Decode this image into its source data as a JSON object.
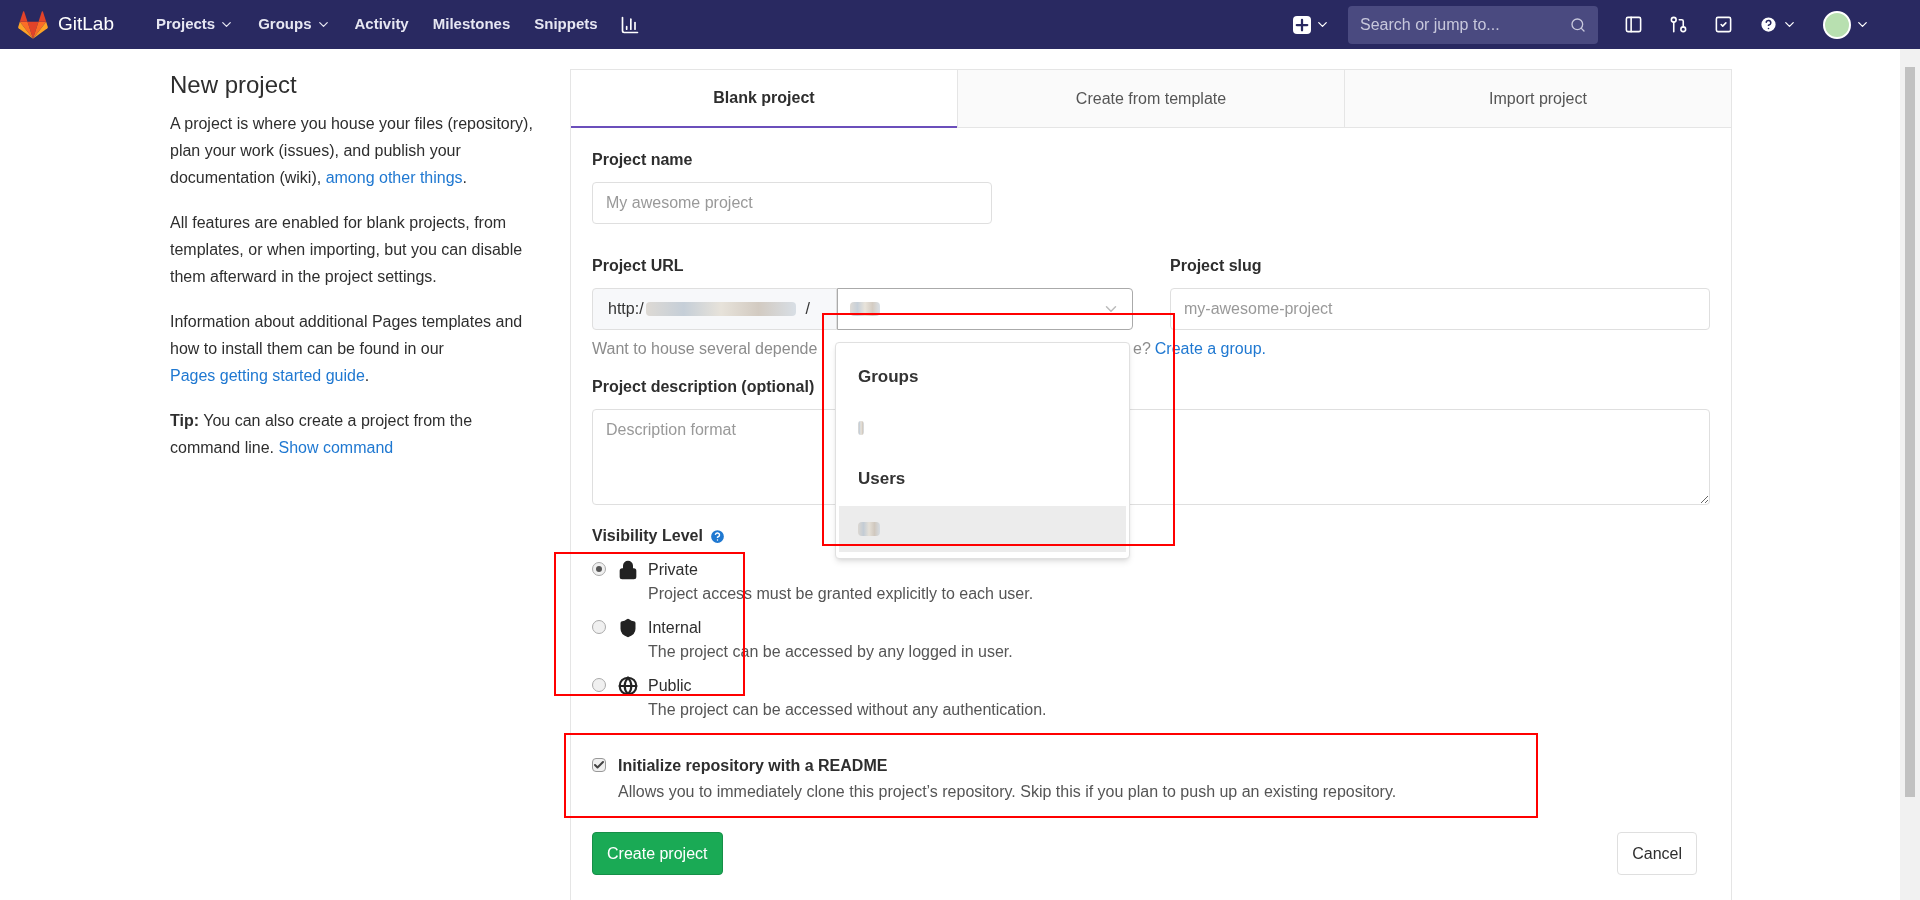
{
  "nav": {
    "brand": "GitLab",
    "items": [
      {
        "label": "Projects",
        "dropdown": true
      },
      {
        "label": "Groups",
        "dropdown": true
      },
      {
        "label": "Activity",
        "dropdown": false
      },
      {
        "label": "Milestones",
        "dropdown": false
      },
      {
        "label": "Snippets",
        "dropdown": false
      }
    ],
    "search": {
      "placeholder": "Search or jump to..."
    }
  },
  "sidebar": {
    "title": "New project",
    "paragraphs": [
      {
        "text": "A project is where you house your files (repository), plan your work (issues), and publish your documentation (wiki), ",
        "link": "among other things",
        "after": "."
      },
      {
        "text": "All features are enabled for blank projects, from templates, or when importing, but you can disable them afterward in the project settings."
      },
      {
        "text": "Information about additional Pages templates and how to install them can be found in our ",
        "link": "Pages getting started guide",
        "after": "."
      },
      {
        "text": "**Tip:** You can also create a project from the command line. ",
        "link": "Show command"
      }
    ]
  },
  "tabs": [
    {
      "label": "Blank project",
      "selected": true
    },
    {
      "label": "Create from template",
      "selected": false
    },
    {
      "label": "Import project",
      "selected": false
    }
  ],
  "form": {
    "project_name": {
      "label": "Project name",
      "placeholder": "My awesome project"
    },
    "project_url": {
      "label": "Project URL",
      "prefix": "http:/",
      "separator": "/"
    },
    "slug": {
      "label": "Project slug",
      "placeholder": "my-awesome-project"
    },
    "help": {
      "before": "Want to house several depende",
      "after": "e?",
      "link": "Create a group",
      "end": "."
    },
    "description": {
      "label": "Project description (optional)",
      "placeholder": "Description format"
    },
    "visibility": {
      "label": "Visibility Level",
      "options": [
        {
          "label": "Private",
          "description": "Project access must be granted explicitly to each user.",
          "selected": true
        },
        {
          "label": "Internal",
          "description": "The project can be accessed by any logged in user.",
          "selected": false
        },
        {
          "label": "Public",
          "description": "The project can be accessed without any authentication.",
          "selected": false
        }
      ]
    },
    "readme": {
      "label": "Initialize repository with a README",
      "description": "Allows you to immediately clone this project’s repository. Skip this if you plan to push up an existing repository.",
      "checked": true
    },
    "buttons": {
      "create": "Create project",
      "cancel": "Cancel"
    }
  },
  "dropdown": {
    "sections": [
      {
        "heading": "Groups",
        "items": [
          {
            "selected": false
          }
        ]
      },
      {
        "heading": "Users",
        "items": [
          {
            "selected": true
          }
        ]
      }
    ]
  }
}
